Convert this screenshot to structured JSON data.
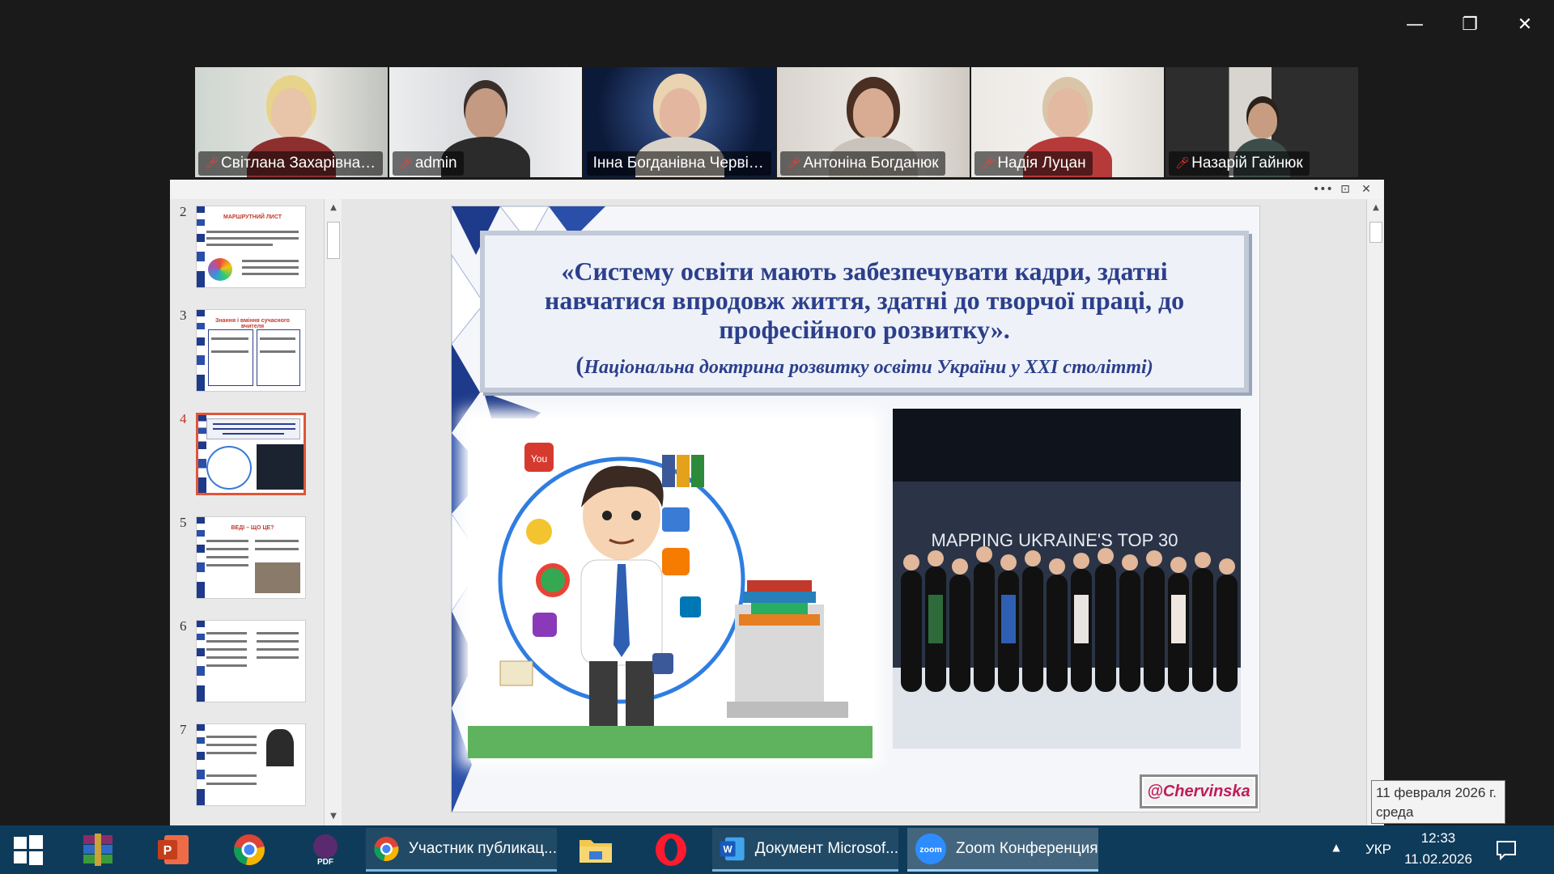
{
  "window": {
    "controls": {
      "minimize": "—",
      "restore": "❐",
      "close": "✕"
    }
  },
  "participants": [
    {
      "name": "Світлана Захарівна Р...",
      "muted": true,
      "active": false
    },
    {
      "name": "admin",
      "muted": true,
      "active": false
    },
    {
      "name": "Інна Богданівна Червінс...",
      "muted": false,
      "active": true
    },
    {
      "name": "Антоніна Богданюк",
      "muted": true,
      "active": false
    },
    {
      "name": "Надія Луцан",
      "muted": true,
      "active": false
    },
    {
      "name": "Назарій Гайнюк",
      "muted": true,
      "active": false
    }
  ],
  "share": {
    "toolbar": {
      "more": "•••",
      "pin": "⊡",
      "close": "✕"
    },
    "thumbnails": [
      {
        "number": "2",
        "title": "МАРШРУТНИЙ ЛИСТ",
        "selected": false
      },
      {
        "number": "3",
        "title": "Знання і вміння сучасного вчителя",
        "selected": false
      },
      {
        "number": "4",
        "title": "",
        "selected": true
      },
      {
        "number": "5",
        "title": "ВЕДІ – ЩО ЦЕ?",
        "selected": false
      },
      {
        "number": "6",
        "title": "",
        "selected": false
      },
      {
        "number": "7",
        "title": "",
        "selected": false
      }
    ],
    "slide": {
      "quote": "«Систему освіти мають забезпечувати кадри, здатні навчатися впродовж життя, здатні до творчої праці, до професійного розвитку».",
      "source_open": "(",
      "source": "Національна доктрина розвитку освіти України у ХХІ столітті)",
      "photo_banner": "MAPPING UKRAINE'S TOP 30",
      "watermark": "@Chervinska"
    }
  },
  "tooltip": {
    "date_line": "11 февраля 2026 г.",
    "weekday": "среда"
  },
  "taskbar": {
    "apps": [
      {
        "id": "start",
        "label": ""
      },
      {
        "id": "winrar",
        "label": ""
      },
      {
        "id": "powerpoint",
        "label": ""
      },
      {
        "id": "chrome-account",
        "label": ""
      },
      {
        "id": "pdf",
        "label": "PDF"
      },
      {
        "id": "chrome-task",
        "label": "Участник публикац..."
      },
      {
        "id": "explorer",
        "label": ""
      },
      {
        "id": "opera",
        "label": ""
      },
      {
        "id": "word",
        "label": "Документ Microsof..."
      },
      {
        "id": "zoom",
        "label": "Zoom Конференция"
      }
    ],
    "language": "УКР",
    "time": "12:33",
    "date": "11.02.2026"
  },
  "colors": {
    "active_speaker": "#23d959",
    "slide_text": "#2b3f8c",
    "watermark": "#c01c5a",
    "taskbar": "#0f3b5a"
  }
}
